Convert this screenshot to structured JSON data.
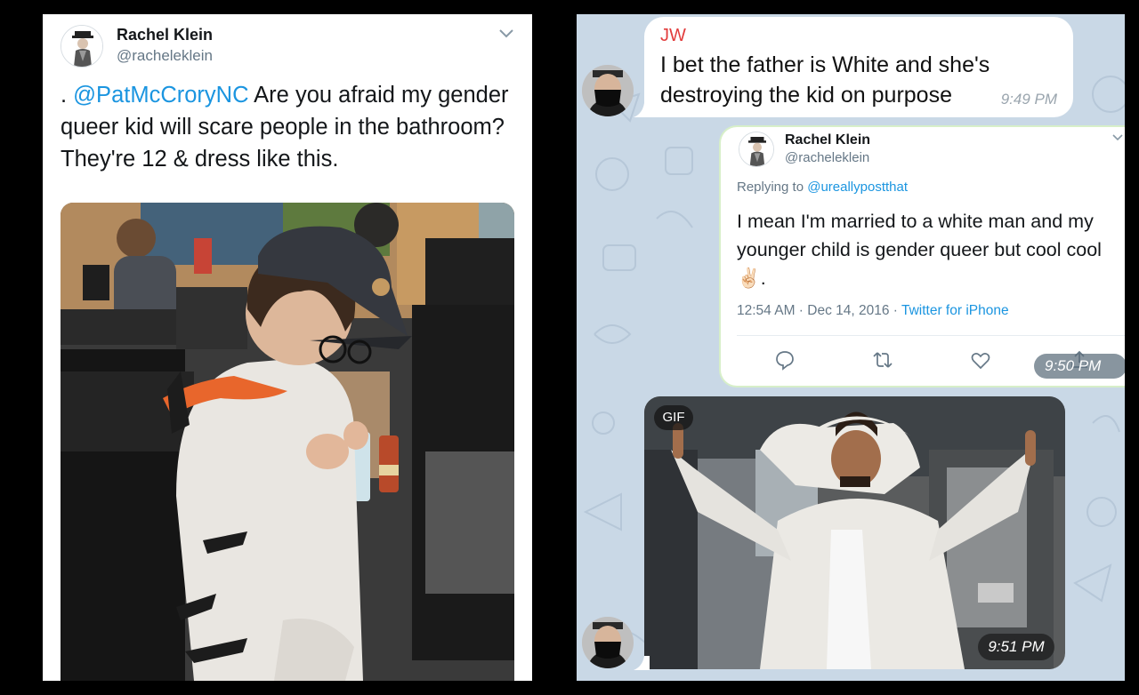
{
  "tweet": {
    "author_name": "Rachel Klein",
    "author_handle": "@racheleklein",
    "text_prefix": ". ",
    "mention": "@PatMcCroryNC",
    "text_body": " Are you afraid my gender queer kid will scare people in the bathroom? They're 12 & dress like this."
  },
  "chat": {
    "message1": {
      "sender": "JW",
      "text": "I bet the father is White and she's destroying the kid on purpose",
      "time": "9:49 PM"
    },
    "forwarded_tweet": {
      "author_name": "Rachel Klein",
      "author_handle": "@racheleklein",
      "replying_label": "Replying to",
      "replying_to": "@ureallypostthat",
      "text": "I mean I'm married to a white man and my younger child is gender queer but cool cool ✌🏻.",
      "date": "12:54 AM · Dec 14, 2016 · ",
      "source": "Twitter for iPhone",
      "time": "9:50 PM ✓✓"
    },
    "gif_message": {
      "badge": "GIF",
      "time": "9:51 PM"
    }
  },
  "colors": {
    "twitter_blue": "#1b95e0",
    "sender_red": "#e23d3d",
    "chat_background": "#c9d8e6"
  }
}
